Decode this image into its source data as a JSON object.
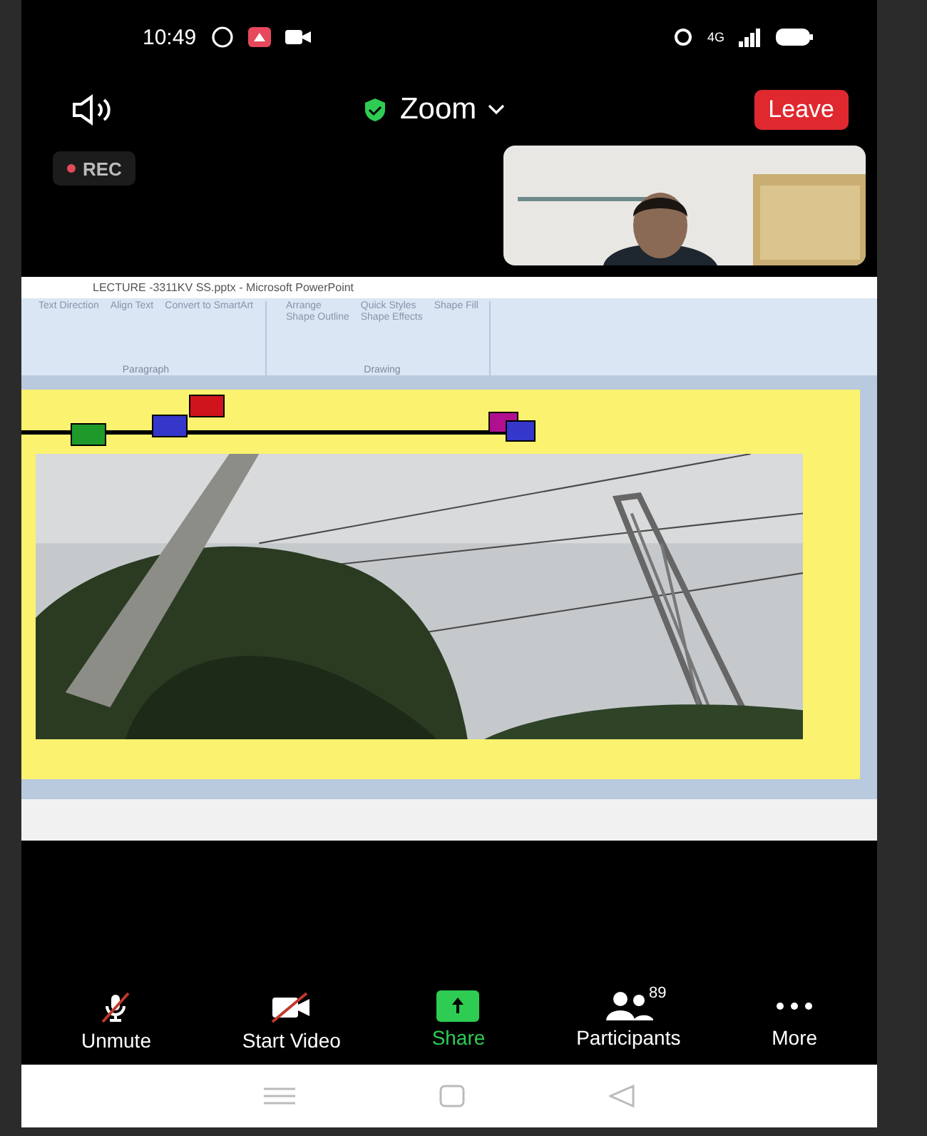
{
  "status_bar": {
    "time": "10:49",
    "signal_label": "4G"
  },
  "header": {
    "title": "Zoom",
    "leave": "Leave"
  },
  "recording": {
    "label": "REC"
  },
  "shared_screen": {
    "window_title": "LECTURE -3311KV SS.pptx - Microsoft PowerPoint",
    "ribbon_groups": [
      {
        "label": "Paragraph",
        "commands": [
          "Text Direction",
          "Align Text",
          "Convert to SmartArt"
        ]
      },
      {
        "label": "Drawing",
        "commands": [
          "Arrange",
          "Quick Styles",
          "Shape Fill",
          "Shape Outline",
          "Shape Effects"
        ]
      }
    ]
  },
  "toolbar": [
    {
      "label": "Unmute",
      "kind": "mic",
      "active": false
    },
    {
      "label": "Start Video",
      "kind": "video",
      "active": false
    },
    {
      "label": "Share",
      "kind": "share",
      "active": true
    },
    {
      "label": "Participants",
      "kind": "participants",
      "active": false,
      "badge": "89"
    },
    {
      "label": "More",
      "kind": "more",
      "active": false
    }
  ]
}
